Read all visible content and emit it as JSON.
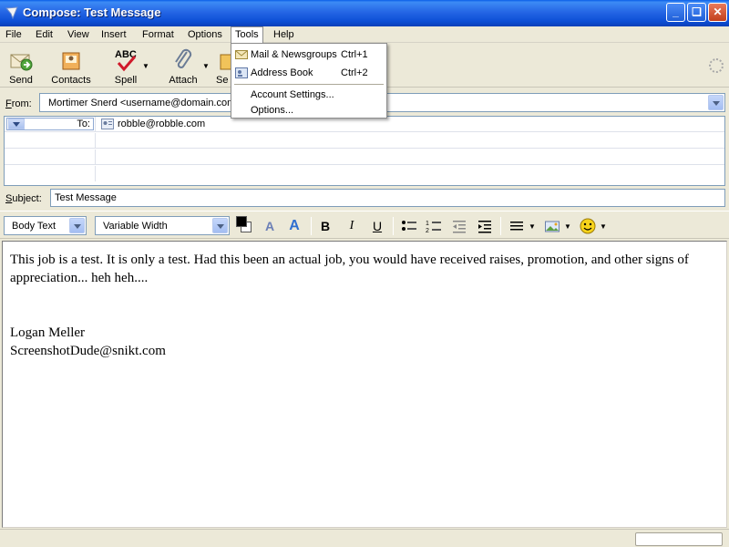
{
  "window": {
    "title": "Compose: Test Message"
  },
  "menu": [
    "File",
    "Edit",
    "View",
    "Insert",
    "Format",
    "Options",
    "Tools",
    "Help"
  ],
  "toolbar": {
    "send": "Send",
    "contacts": "Contacts",
    "spell": "Spell",
    "attach": "Attach",
    "security_partial": "Se"
  },
  "tools_menu": {
    "items": [
      {
        "label": "Mail & Newsgroups",
        "shortcut": "Ctrl+1"
      },
      {
        "label": "Address Book",
        "shortcut": "Ctrl+2"
      },
      {
        "label": "Account Settings...",
        "shortcut": ""
      },
      {
        "label": "Options...",
        "shortcut": ""
      }
    ]
  },
  "compose": {
    "from_label": "From:",
    "from_value": "Mortimer Snerd <username@domain.com",
    "to_label": "To:",
    "to_value": "robble@robble.com",
    "subject_label": "Subject:",
    "subject_value": "Test Message"
  },
  "format": {
    "paragraph_style": "Body Text",
    "font": "Variable Width",
    "bold": "B",
    "italic": "I",
    "underline": "U"
  },
  "message": {
    "line1": "This job is a test.  It is only a test.  Had this been an actual job, you would have received raises, promotion, and other signs of appreciation... heh heh....",
    "sig_name": "Logan Meller",
    "sig_email": "ScreenshotDude@snikt.com"
  },
  "colors": {
    "title_blue": "#0d4fd6",
    "menu_highlight": "#316ac5",
    "text_color_swatch": "#000000"
  }
}
